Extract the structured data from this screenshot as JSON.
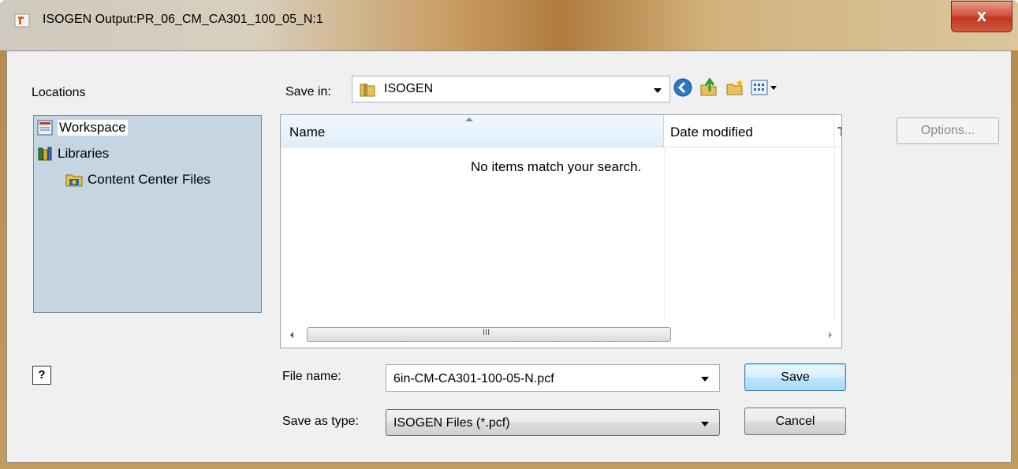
{
  "window": {
    "title": "ISOGEN Output:PR_06_CM_CA301_100_05_N:1",
    "close_glyph": "x"
  },
  "locations": {
    "heading": "Locations",
    "items": [
      {
        "label": "Workspace",
        "icon": "workspace-icon",
        "selected": true
      },
      {
        "label": "Libraries",
        "icon": "libraries-icon",
        "selected": false
      },
      {
        "label": "Content Center Files",
        "icon": "content-center-folder-icon",
        "selected": false
      }
    ]
  },
  "save_in": {
    "label": "Save in:",
    "value": "ISOGEN"
  },
  "toolbar": {
    "icons": [
      "back-icon",
      "up-folder-icon",
      "new-folder-icon",
      "view-menu-icon"
    ]
  },
  "file_list": {
    "columns": [
      "Name",
      "Date modified",
      "Ty"
    ],
    "empty_message": "No items match your search.",
    "scroll_grip": "III"
  },
  "options_button": "Options...",
  "help_glyph": "?",
  "file_name": {
    "label": "File name:",
    "value": "6in-CM-CA301-100-05-N.pcf"
  },
  "save_as_type": {
    "label": "Save as type:",
    "value": "ISOGEN Files (*.pcf)"
  },
  "buttons": {
    "save": "Save",
    "cancel": "Cancel"
  },
  "colors": {
    "locations_bg": "#c6d5e2",
    "close_button": "#c2361f"
  }
}
